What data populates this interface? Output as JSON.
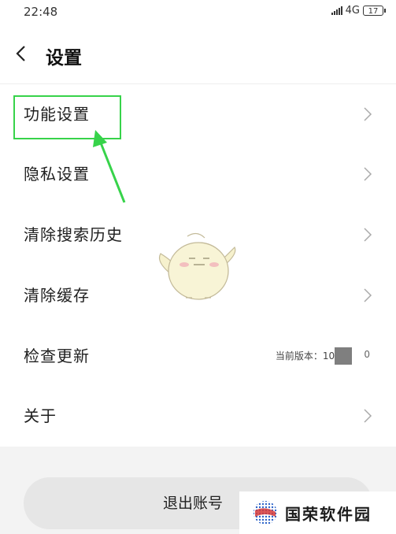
{
  "status_bar": {
    "time": "22:48",
    "network": "4G",
    "battery": "17"
  },
  "header": {
    "title": "设置"
  },
  "menu": {
    "items": [
      {
        "label": "功能设置"
      },
      {
        "label": "隐私设置"
      },
      {
        "label": "清除搜索历史"
      },
      {
        "label": "清除缓存"
      },
      {
        "label": "检查更新",
        "version_prefix": "当前版本：10.",
        "version_suffix": "0"
      },
      {
        "label": "关于"
      }
    ]
  },
  "footer": {
    "logout_label": "退出账号"
  },
  "watermark": {
    "text": "国荣软件园"
  },
  "colors": {
    "highlight": "#37d34a",
    "arrow": "#37d34a",
    "footer_bg": "#f3f3f3"
  }
}
